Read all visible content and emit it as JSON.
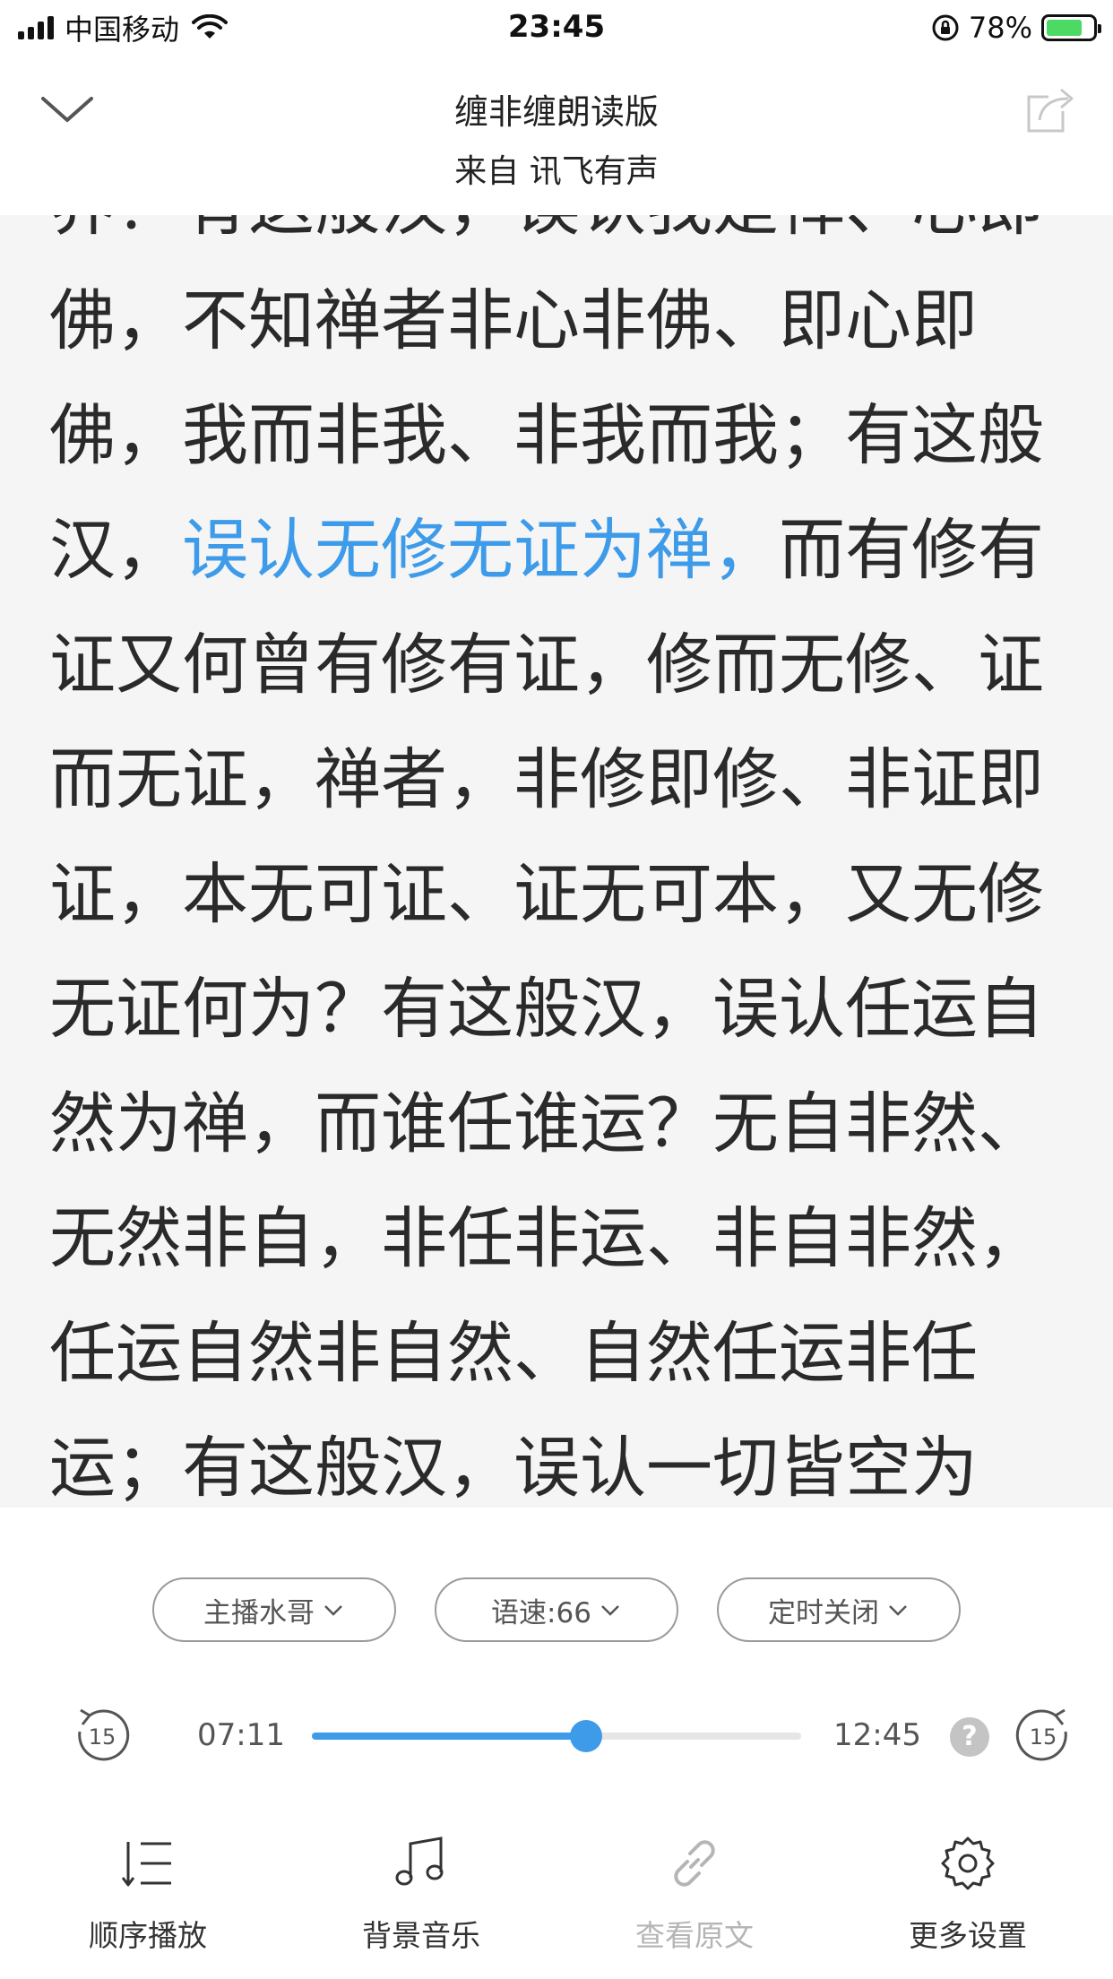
{
  "status_bar": {
    "carrier": "中国移动",
    "time": "23:45",
    "battery_percent": "78%",
    "battery_level": 0.78,
    "icons": [
      "signal-icon",
      "wifi-icon",
      "orientation-lock-icon",
      "battery-charging-icon"
    ]
  },
  "header": {
    "title": "缠非缠朗读版",
    "subtitle": "来自 讯飞有声",
    "icons": [
      "chevron-down-icon",
      "share-icon"
    ]
  },
  "reader": {
    "paragraph_before": "界？有这般汉，误认我是禅、心即佛，不知禅者非心非佛、即心即佛，我而非我、非我而我；有这般汉，",
    "highlighted": "误认无修无证为禅，",
    "paragraph_after": "而有修有证又何曾有修有证，修而无修、证而无证，禅者，非修即修、非证即证，本无可证、证无可本，又无修无证何为？有这般汉，误认任运自然为禅，而谁任谁运？无自非然、无然非自，非任非运、非自非然，任运自然非自然、自然任运非任运；有这般汉，误认一切皆空为",
    "highlight_color": "#3d9be9"
  },
  "options": {
    "anchor": "主播水哥",
    "speed": "语速:66",
    "timer": "定时关闭"
  },
  "player": {
    "current_time": "07:11",
    "total_time": "12:45",
    "progress": 0.56,
    "skip_back_seconds": "15",
    "skip_forward_seconds": "15",
    "help_symbol": "?",
    "accent_color": "#3d9be9"
  },
  "bottom_menu": {
    "order_play": "顺序播放",
    "bg_music": "背景音乐",
    "view_source": "查看原文",
    "more_settings": "更多设置"
  }
}
